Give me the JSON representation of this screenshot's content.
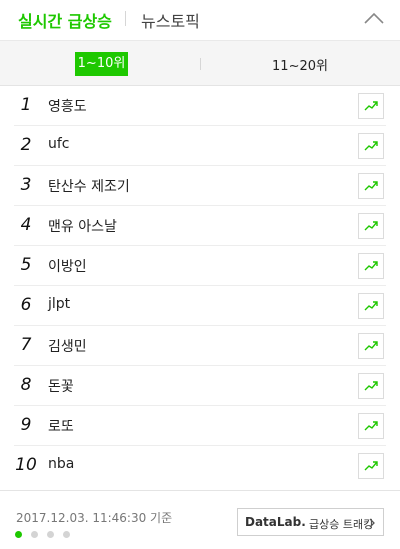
{
  "header": {
    "tab_realtime": "실시간 급상승",
    "tab_news": "뉴스토픽",
    "collapse_icon": "chevron-up-icon"
  },
  "range_tabs": {
    "selected": "1~10위",
    "other": "11~20위"
  },
  "keywords": [
    {
      "rank": "1",
      "keyword": "영흥도"
    },
    {
      "rank": "2",
      "keyword": "ufc"
    },
    {
      "rank": "3",
      "keyword": "탄산수 제조기"
    },
    {
      "rank": "4",
      "keyword": "맨유 아스날"
    },
    {
      "rank": "5",
      "keyword": "이방인"
    },
    {
      "rank": "6",
      "keyword": "jlpt"
    },
    {
      "rank": "7",
      "keyword": "김생민"
    },
    {
      "rank": "8",
      "keyword": "돈꽃"
    },
    {
      "rank": "9",
      "keyword": "로또"
    },
    {
      "rank": "10",
      "keyword": "nba"
    }
  ],
  "row_icon": "trend-chart-icon",
  "footer": {
    "timestamp": "2017.12.03. 11:46:30 기준",
    "page_indicator": {
      "current": 1,
      "total": 4
    },
    "datalab_brand": "DataLab.",
    "datalab_label": "급상승 트래킹"
  },
  "colors": {
    "accent": "#1ec800",
    "text": "#222222",
    "muted": "#777777",
    "border": "#dcdcdc",
    "tab_background": "#f5f5f5"
  }
}
